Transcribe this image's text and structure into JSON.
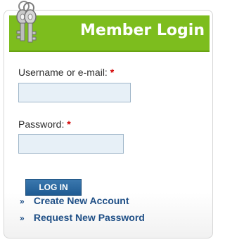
{
  "header": {
    "title": "Member Login"
  },
  "form": {
    "username_label": "Username or e-mail:",
    "password_label": "Password:",
    "required_mark": "*",
    "username_value": "",
    "password_value": "",
    "login_button": "LOG IN"
  },
  "links": {
    "bullet": "»",
    "create_account": "Create New Account",
    "request_password": "Request New Password"
  },
  "colors": {
    "header": "#7dbd1e",
    "button": "#2a6aa0",
    "link": "#1f4f86",
    "required": "#d30000"
  },
  "icons": {
    "header_icon": "keys-icon"
  }
}
